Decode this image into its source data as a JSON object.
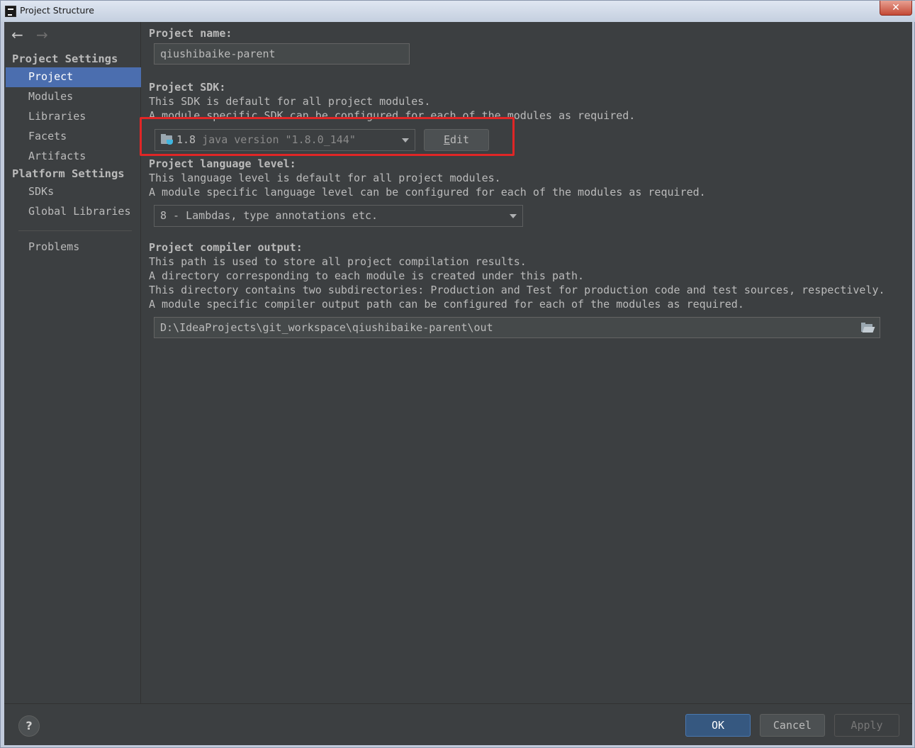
{
  "window": {
    "title": "Project Structure",
    "close_glyph": "✕"
  },
  "nav": {
    "back_glyph": "←",
    "forward_glyph": "→"
  },
  "sidebar": {
    "project_settings_header": "Project Settings",
    "project_settings_items": [
      {
        "label": "Project",
        "selected": true
      },
      {
        "label": "Modules",
        "selected": false
      },
      {
        "label": "Libraries",
        "selected": false
      },
      {
        "label": "Facets",
        "selected": false
      },
      {
        "label": "Artifacts",
        "selected": false
      }
    ],
    "platform_settings_header": "Platform Settings",
    "platform_settings_items": [
      {
        "label": "SDKs"
      },
      {
        "label": "Global Libraries"
      }
    ],
    "problems_label": "Problems"
  },
  "main": {
    "project_name": {
      "label": "Project name:",
      "value": "qiushibaike-parent"
    },
    "project_sdk": {
      "label": "Project SDK:",
      "desc_line1": "This SDK is default for all project modules.",
      "desc_line2": "A module specific SDK can be configured for each of the modules as required.",
      "sdk_name": "1.8",
      "sdk_version": "java version \"1.8.0_144\"",
      "edit_button_mnemonic": "E",
      "edit_button_rest": "dit",
      "highlight_color": "#e02626"
    },
    "language_level": {
      "label": "Project language level:",
      "desc_line1": "This language level is default for all project modules.",
      "desc_line2": "A module specific language level can be configured for each of the modules as required.",
      "value": "8 - Lambdas, type annotations etc."
    },
    "compiler_output": {
      "label": "Project compiler output:",
      "desc_line1": "This path is used to store all project compilation results.",
      "desc_line2": "A directory corresponding to each module is created under this path.",
      "desc_line3": "This directory contains two subdirectories: Production and Test for production code and test sources, respectively.",
      "desc_line4": "A module specific compiler output path can be configured for each of the modules as required.",
      "value": "D:\\IdeaProjects\\git_workspace\\qiushibaike-parent\\out"
    }
  },
  "buttons": {
    "help": "?",
    "ok": "OK",
    "cancel": "Cancel",
    "apply": "Apply"
  },
  "colors": {
    "background": "#3c3f41",
    "selection": "#4b6eaf",
    "ok_button": "#365880"
  }
}
